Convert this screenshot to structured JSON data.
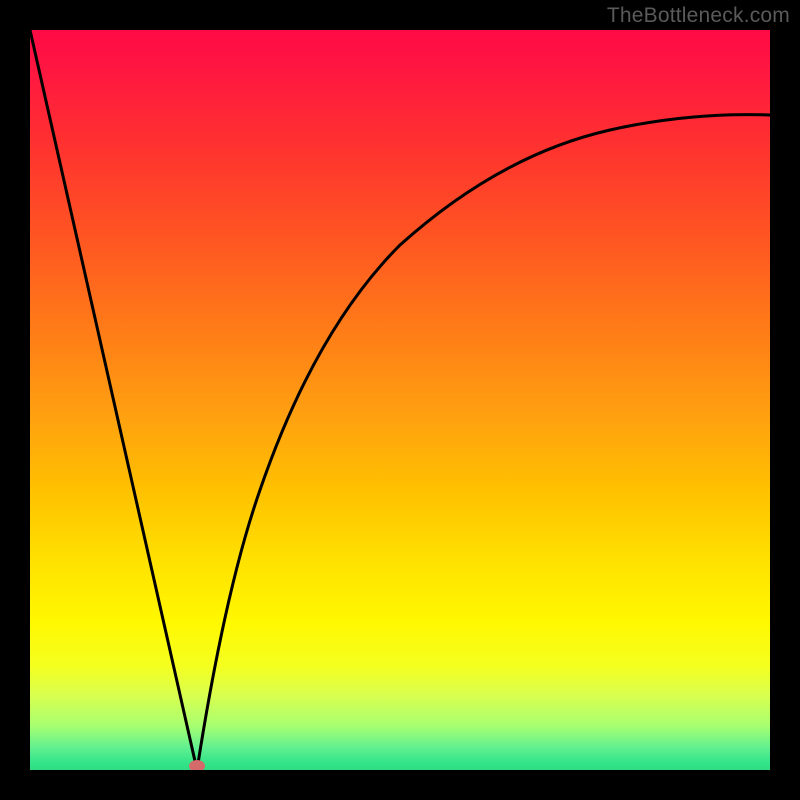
{
  "watermark": "TheBottleneck.com",
  "chart_data": {
    "type": "line",
    "title": "",
    "xlabel": "",
    "ylabel": "",
    "xlim": [
      0,
      1
    ],
    "ylim": [
      0,
      1
    ],
    "marker": {
      "x": 0.225,
      "y": 0.0,
      "color": "#d46a6a"
    },
    "series": [
      {
        "name": "left-branch",
        "x": [
          0.0,
          0.05,
          0.1,
          0.15,
          0.2,
          0.225
        ],
        "y": [
          1.0,
          0.78,
          0.56,
          0.34,
          0.11,
          0.0
        ]
      },
      {
        "name": "right-branch",
        "x": [
          0.225,
          0.25,
          0.28,
          0.31,
          0.35,
          0.4,
          0.46,
          0.53,
          0.61,
          0.7,
          0.8,
          0.9,
          1.0
        ],
        "y": [
          0.0,
          0.13,
          0.26,
          0.37,
          0.48,
          0.58,
          0.66,
          0.73,
          0.78,
          0.82,
          0.85,
          0.87,
          0.885
        ]
      }
    ]
  }
}
